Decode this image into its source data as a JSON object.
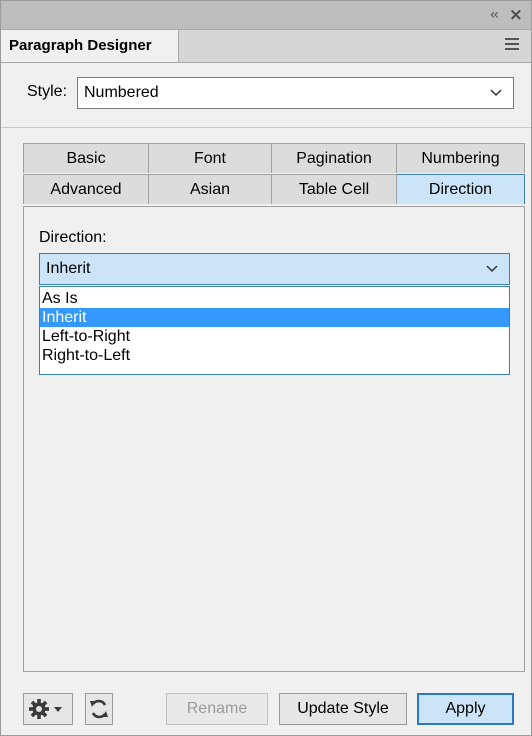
{
  "window": {
    "panel_tab_label": "Paragraph Designer"
  },
  "style": {
    "label": "Style:",
    "selected": "Numbered"
  },
  "tabs": {
    "row1": [
      "Basic",
      "Font",
      "Pagination",
      "Numbering"
    ],
    "row2": [
      "Advanced",
      "Asian",
      "Table Cell",
      "Direction"
    ],
    "active": "Direction"
  },
  "direction": {
    "label": "Direction:",
    "selected": "Inherit",
    "options": [
      "As Is",
      "Inherit",
      "Left-to-Right",
      "Right-to-Left"
    ],
    "highlighted": "Inherit"
  },
  "buttons": {
    "rename": "Rename",
    "update_style": "Update Style",
    "apply": "Apply"
  },
  "icons": {
    "collapse": "double-chevron-left-icon",
    "close": "close-icon",
    "menu": "hamburger-menu-icon",
    "settings": "gear-icon",
    "refresh": "refresh-icon",
    "dropdown": "chevron-down-icon"
  },
  "colors": {
    "accent": "#3399ff",
    "active_tab": "#cce4f7",
    "focus_border": "#3c7fb1"
  }
}
